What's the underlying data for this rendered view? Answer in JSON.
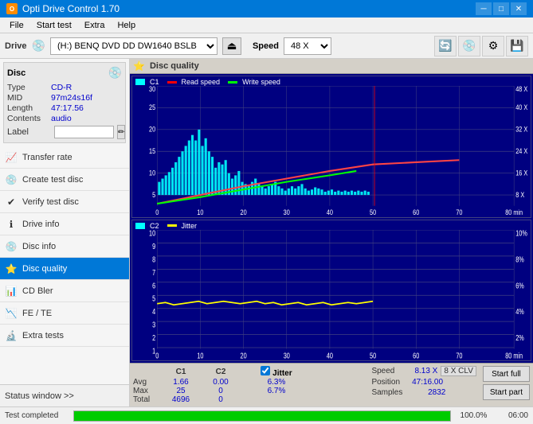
{
  "titleBar": {
    "title": "Opti Drive Control 1.70",
    "minBtn": "─",
    "maxBtn": "□",
    "closeBtn": "✕"
  },
  "menuBar": {
    "items": [
      "File",
      "Start test",
      "Extra",
      "Help"
    ]
  },
  "driveBar": {
    "driveLabel": "Drive",
    "driveValue": "(H:)  BENQ DVD DD DW1640 BSLB",
    "speedLabel": "Speed",
    "speedValue": "48 X"
  },
  "disc": {
    "panelTitle": "Disc",
    "typeLabel": "Type",
    "typeValue": "CD-R",
    "midLabel": "MID",
    "midValue": "97m24s16f",
    "lengthLabel": "Length",
    "lengthValue": "47:17.56",
    "contentsLabel": "Contents",
    "contentsValue": "audio",
    "labelLabel": "Label"
  },
  "sidebar": {
    "navItems": [
      {
        "id": "transfer-rate",
        "label": "Transfer rate",
        "icon": "📈"
      },
      {
        "id": "create-test-disc",
        "label": "Create test disc",
        "icon": "💿"
      },
      {
        "id": "verify-test-disc",
        "label": "Verify test disc",
        "icon": "✔"
      },
      {
        "id": "drive-info",
        "label": "Drive info",
        "icon": "ℹ"
      },
      {
        "id": "disc-info",
        "label": "Disc info",
        "icon": "💿"
      },
      {
        "id": "disc-quality",
        "label": "Disc quality",
        "icon": "⭐",
        "active": true
      },
      {
        "id": "cd-bler",
        "label": "CD Bler",
        "icon": "📊"
      },
      {
        "id": "fe-te",
        "label": "FE / TE",
        "icon": "📉"
      },
      {
        "id": "extra-tests",
        "label": "Extra tests",
        "icon": "🔬"
      }
    ],
    "statusWindowLabel": "Status window >>"
  },
  "contentHeader": {
    "title": "Disc quality",
    "icon": "⭐"
  },
  "chart1": {
    "title": "C1",
    "legend": [
      {
        "label": "C1",
        "color": "#00ffff"
      },
      {
        "label": "Read speed",
        "color": "#ff0000"
      },
      {
        "label": "Write speed",
        "color": "#00ff00"
      }
    ],
    "yLabels": [
      "30",
      "25",
      "20",
      "15",
      "10",
      "5"
    ],
    "yLabelsRight": [
      "48 X",
      "40 X",
      "32 X",
      "24 X",
      "16 X",
      "8 X"
    ],
    "xLabels": [
      "0",
      "10",
      "20",
      "30",
      "40",
      "50",
      "60",
      "70",
      "80 min"
    ]
  },
  "chart2": {
    "title": "C2",
    "legend": [
      {
        "label": "C2",
        "color": "#00ffff"
      },
      {
        "label": "Jitter",
        "color": "#ffff00"
      }
    ],
    "yLabels": [
      "10",
      "9",
      "8",
      "7",
      "6",
      "5",
      "4",
      "3",
      "2",
      "1"
    ],
    "yLabelsRight": [
      "10%",
      "8%",
      "6%",
      "4%",
      "2%"
    ],
    "xLabels": [
      "0",
      "10",
      "20",
      "30",
      "40",
      "50",
      "60",
      "70",
      "80 min"
    ]
  },
  "stats": {
    "columns": {
      "c1Header": "C1",
      "c2Header": "C2",
      "jitterHeader": "Jitter"
    },
    "rows": [
      {
        "label": "Avg",
        "c1": "1.66",
        "c2": "0.00",
        "jitter": "6.3%"
      },
      {
        "label": "Max",
        "c1": "25",
        "c2": "0",
        "jitter": "6.7%"
      },
      {
        "label": "Total",
        "c1": "4696",
        "c2": "0",
        "jitter": ""
      }
    ],
    "jitterCheckbox": true,
    "speed": {
      "label": "Speed",
      "value": "8.13 X",
      "unit": "8 X CLV"
    },
    "position": {
      "label": "Position",
      "value": "47:16.00"
    },
    "samples": {
      "label": "Samples",
      "value": "2832"
    },
    "startFullBtn": "Start full",
    "startPartBtn": "Start part"
  },
  "bottomBar": {
    "statusText": "Test completed",
    "progressPercent": 100,
    "progressText": "100.0%",
    "timeText": "06:00"
  }
}
